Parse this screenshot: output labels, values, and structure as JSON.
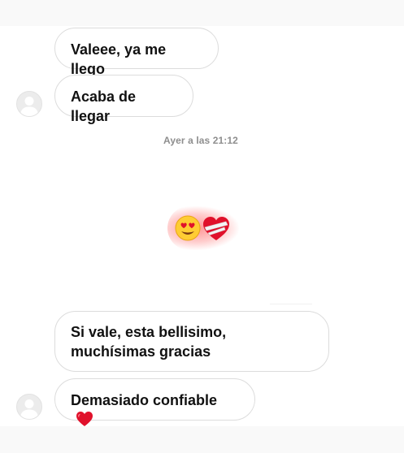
{
  "thread": {
    "messages": [
      {
        "text": "Valeee, ya me llego"
      },
      {
        "text": "Acaba de llegar"
      },
      {
        "text": "Si vale, esta bellisimo, muchísimas gracias"
      },
      {
        "text": "Demasiado confiable"
      }
    ],
    "timestamp": "Ayer a las 21:12",
    "reaction_emojis": [
      "smiling-face-with-heart-eyes-icon",
      "mending-heart-icon"
    ],
    "message_4_emoji": "red-heart-icon"
  },
  "colors": {
    "bubble_border": "#dcdcdc",
    "text": "#111111",
    "timestamp": "#8e8e8e",
    "heart_red": "#e0112b",
    "glow_red": "#ff3c3c"
  }
}
